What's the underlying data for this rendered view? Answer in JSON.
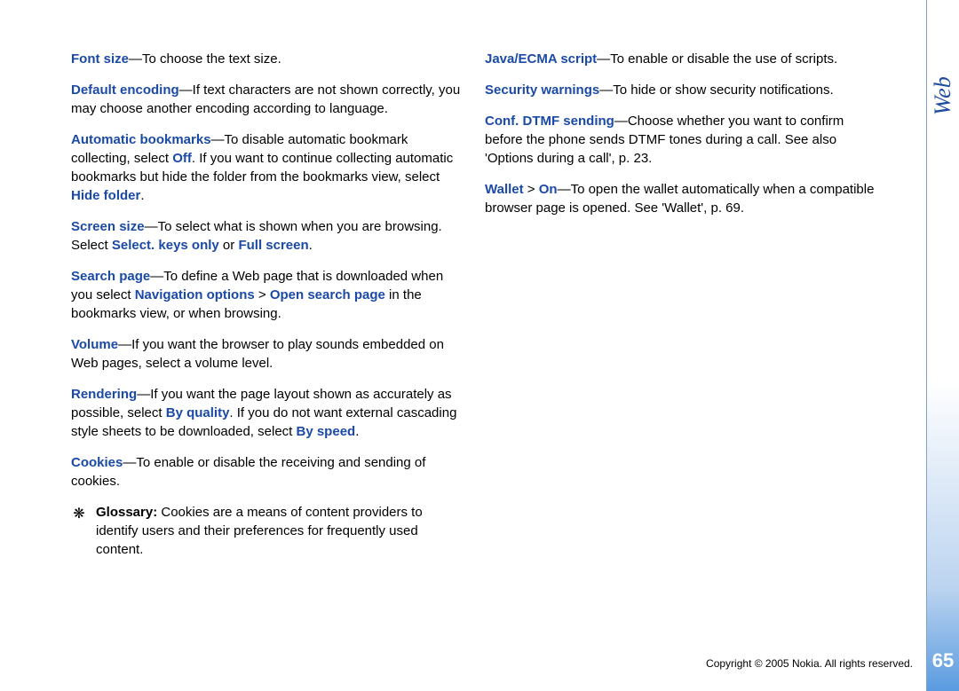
{
  "tab_label": "Web",
  "page_number": "65",
  "copyright": "Copyright © 2005 Nokia. All rights reserved.",
  "left_col": {
    "font_size": {
      "k": "Font size",
      "t": "—To choose the text size."
    },
    "default_encoding": {
      "k": "Default encoding",
      "t": "—If text characters are not shown correctly, you may choose another encoding according to language."
    },
    "auto_bookmarks": {
      "k": "Automatic bookmarks",
      "t1": "—To disable automatic bookmark collecting, select ",
      "off": "Off",
      "t2": ". If you want to continue collecting automatic bookmarks but hide the folder from the bookmarks view, select ",
      "hide": "Hide folder",
      "t3": "."
    },
    "screen_size": {
      "k": "Screen size",
      "t1": "—To select what is shown when you are browsing. Select ",
      "opt1": "Select. keys only",
      "or": " or ",
      "opt2": "Full screen",
      "t2": "."
    },
    "search_page": {
      "k": "Search page",
      "t1": "—To define a Web page that is downloaded when you select ",
      "nav": "Navigation options",
      "gt": " > ",
      "open": "Open search page",
      "t2": " in the bookmarks view, or when browsing."
    },
    "volume": {
      "k": "Volume",
      "t": "—If you want the browser to play sounds embedded on Web pages, select a volume level."
    },
    "rendering": {
      "k": "Rendering",
      "t1": "—If you want the page layout shown as accurately as possible, select ",
      "q": "By quality",
      "t2": ". If you do not want external cascading style sheets to be downloaded, select ",
      "s": "By speed",
      "t3": "."
    },
    "cookies": {
      "k": "Cookies",
      "t": "—To enable or disable the receiving and sending of cookies."
    },
    "glossary": {
      "label": "Glossary:",
      "text": " Cookies are a means of content providers to identify users and their preferences for frequently used content."
    }
  },
  "right_col": {
    "java": {
      "k": "Java/ECMA script",
      "t": "—To enable or disable the use of scripts."
    },
    "security": {
      "k": "Security warnings",
      "t": "—To hide or show security notifications."
    },
    "dtmf": {
      "k": "Conf. DTMF sending",
      "t": "—Choose whether you want to confirm before the phone sends DTMF tones during a call. See also 'Options during a call', p. 23."
    },
    "wallet": {
      "k": "Wallet",
      "gt": " > ",
      "on": "On",
      "t": "—To open the wallet automatically when a compatible browser page is opened. See 'Wallet', p. 69."
    }
  }
}
